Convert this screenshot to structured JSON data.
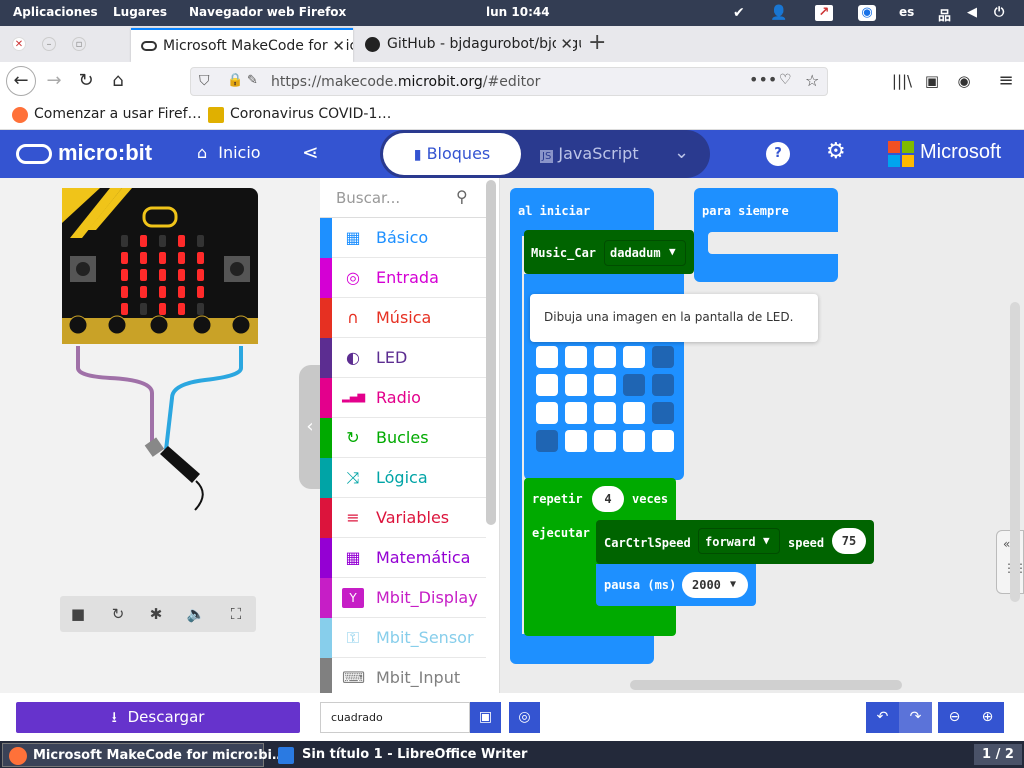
{
  "system_bar": {
    "apps": "Aplicaciones",
    "places": "Lugares",
    "browser": "Navegador web Firefox",
    "clock": "lun 10:44",
    "lang": "es"
  },
  "tabs": [
    {
      "title": "Microsoft MakeCode for micro:bit",
      "active": true
    },
    {
      "title": "GitHub - bjdagurobot/bjdagurobot",
      "active": false
    }
  ],
  "url": {
    "prefix": "https://makecode.",
    "domain": "microbit.org",
    "suffix": "/#editor"
  },
  "bookmarks": [
    "Comenzar a usar Firef…",
    "Coronavirus COVID-1…"
  ],
  "header": {
    "logo": "micro:bit",
    "home": "Inicio",
    "blocks": "Bloques",
    "javascript": "JavaScript",
    "brand": "Microsoft"
  },
  "toolbox": {
    "search_placeholder": "Buscar...",
    "categories": [
      {
        "label": "Básico",
        "color": "#1e90ff",
        "icon": "grid-icon"
      },
      {
        "label": "Entrada",
        "color": "#d400d4",
        "icon": "target-icon"
      },
      {
        "label": "Música",
        "color": "#e63022",
        "icon": "headphones-icon"
      },
      {
        "label": "LED",
        "color": "#5c2d91",
        "icon": "toggle-icon"
      },
      {
        "label": "Radio",
        "color": "#e3008c",
        "icon": "signal-icon"
      },
      {
        "label": "Bucles",
        "color": "#00aa00",
        "icon": "loop-icon"
      },
      {
        "label": "Lógica",
        "color": "#00a4a6",
        "icon": "shuffle-icon"
      },
      {
        "label": "Variables",
        "color": "#dc143c",
        "icon": "lines-icon"
      },
      {
        "label": "Matemática",
        "color": "#9400d3",
        "icon": "calculator-icon"
      },
      {
        "label": "Mbit_Display",
        "color": "#c61ec6",
        "icon": "y-icon"
      },
      {
        "label": "Mbit_Sensor",
        "color": "#87ceeb",
        "icon": "wrench-icon"
      },
      {
        "label": "Mbit_Input",
        "color": "#808080",
        "icon": "keyboard-icon"
      }
    ]
  },
  "blocks": {
    "on_start": "al iniciar",
    "forever": "para siempre",
    "music_car": "Music_Car",
    "music_value": "dadadum",
    "tooltip": "Dibuja una imagen en la pantalla de LED.",
    "repeat": "repetir",
    "repeat_count": "4",
    "times": "veces",
    "do": "ejecutar",
    "car_speed": "CarCtrlSpeed",
    "direction": "forward",
    "speed_label": "speed",
    "speed_value": "75",
    "pause": "pausa (ms)",
    "pause_value": "2000",
    "led_grid": [
      [
        0,
        0,
        0,
        0,
        1
      ],
      [
        0,
        0,
        0,
        1,
        1
      ],
      [
        0,
        0,
        0,
        0,
        1
      ],
      [
        1,
        0,
        0,
        0,
        0
      ]
    ]
  },
  "footer": {
    "download": "Descargar",
    "project_name": "cuadrado"
  },
  "taskbar": {
    "firefox": "Microsoft MakeCode for micro:bi…",
    "writer": "Sin título 1 - LibreOffice Writer",
    "workspace": "1 / 2"
  }
}
